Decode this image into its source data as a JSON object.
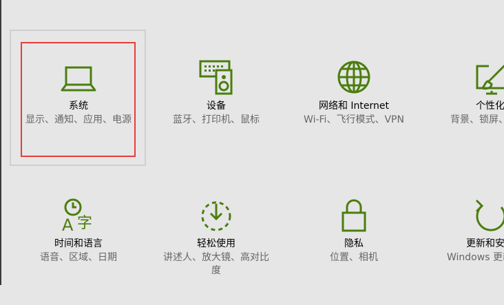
{
  "settings": {
    "accent_color": "#4b7d0e",
    "tiles": [
      {
        "title": "系统",
        "desc": "显示、通知、应用、电源",
        "icon": "laptop-icon"
      },
      {
        "title": "设备",
        "desc": "蓝牙、打印机、鼠标",
        "icon": "devices-icon"
      },
      {
        "title": "网络和 Internet",
        "desc": "Wi-Fi、飞行模式、VPN",
        "icon": "globe-icon"
      },
      {
        "title": "个性化",
        "desc": "背景、锁屏、颜色",
        "icon": "personalization-icon"
      },
      {
        "title": "时间和语言",
        "desc": "语音、区域、日期",
        "icon": "time-language-icon"
      },
      {
        "title": "轻松使用",
        "desc": "讲述人、放大镜、高对比度",
        "icon": "ease-of-access-icon"
      },
      {
        "title": "隐私",
        "desc": "位置、相机",
        "icon": "lock-icon"
      },
      {
        "title": "更新和安全",
        "desc": "Windows 更新、恢复、备份",
        "icon": "update-icon"
      }
    ]
  }
}
